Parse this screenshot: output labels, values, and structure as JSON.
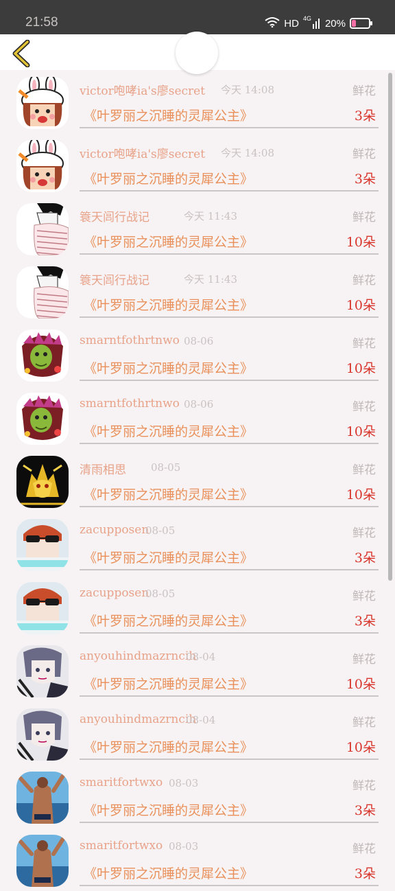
{
  "status_bar": {
    "time": "21:58",
    "hd": "HD",
    "network": "4G",
    "battery": "20%"
  },
  "colors": {
    "name": "#e8a289",
    "title": "#e9905a",
    "qty": "#d8352c",
    "gift": "#c0b8b8",
    "back_arrow": "#e3c336"
  },
  "gift_label": "鲜花",
  "book_title": "《叶罗丽之沉睡的灵犀公主》",
  "rows": [
    {
      "name": "victor咆哮ia's廖secret",
      "time": "今天 14:08",
      "qty": "3朵",
      "avatar": "rabbit-avatar"
    },
    {
      "name": "victor咆哮ia's廖secret",
      "time": "今天 14:08",
      "qty": "3朵",
      "avatar": "rabbit-avatar"
    },
    {
      "name": "簑天闾行战记",
      "time": "今天 11:43",
      "qty": "10朵",
      "avatar": "sketch-avatar"
    },
    {
      "name": "簑天闾行战记",
      "time": "今天 11:43",
      "qty": "10朵",
      "avatar": "sketch-avatar"
    },
    {
      "name": "smarntfothrtnwo",
      "time": "08-06",
      "qty": "10朵",
      "avatar": "goblin-avatar"
    },
    {
      "name": "smarntfothrtnwo",
      "time": "08-06",
      "qty": "10朵",
      "avatar": "goblin-avatar"
    },
    {
      "name": "清雨相思",
      "time": "08-05",
      "qty": "10朵",
      "avatar": "golden-beast-avatar"
    },
    {
      "name": "zacupposen",
      "time": "08-05",
      "qty": "3朵",
      "avatar": "sunglasses-avatar"
    },
    {
      "name": "zacupposen",
      "time": "08-05",
      "qty": "3朵",
      "avatar": "sunglasses-avatar"
    },
    {
      "name": "anyouhindmazrncih",
      "time": "08-04",
      "qty": "10朵",
      "avatar": "anime-avatar"
    },
    {
      "name": "anyouhindmazrncih",
      "time": "08-04",
      "qty": "10朵",
      "avatar": "anime-avatar"
    },
    {
      "name": "smaritfortwxo",
      "time": "08-03",
      "qty": "3朵",
      "avatar": "beach-avatar"
    },
    {
      "name": "smaritfortwxo",
      "time": "08-03",
      "qty": "3朵",
      "avatar": "beach-avatar"
    }
  ]
}
